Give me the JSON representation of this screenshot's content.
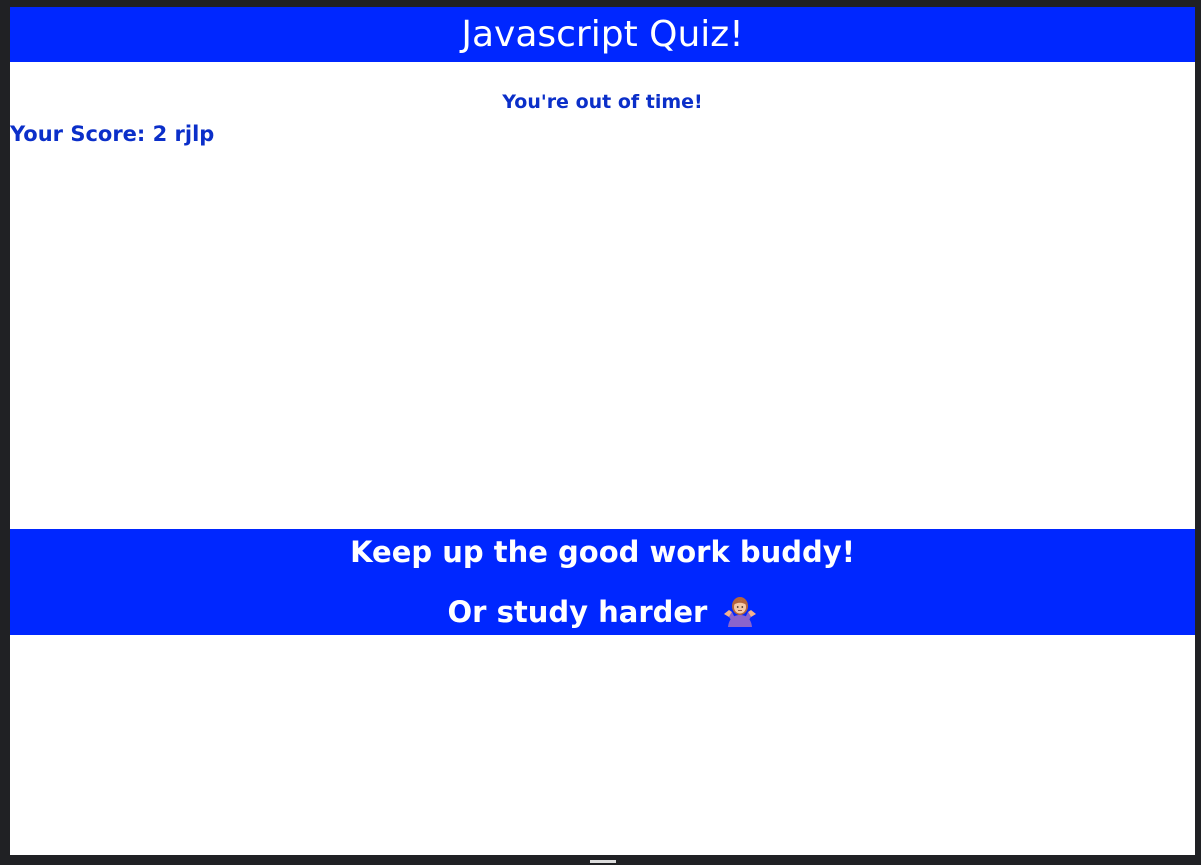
{
  "header": {
    "title": "Javascript Quiz!"
  },
  "result": {
    "timeout_message": "You're out of time!",
    "score_text": "Your Score: 2 rjlp"
  },
  "footer": {
    "line1": "Keep up the good work buddy!",
    "line2": "Or study harder"
  },
  "icons": {
    "shrug": "woman-shrugging-icon"
  },
  "colors": {
    "brand_blue": "#0027ff",
    "text_blue": "#0b2fc9",
    "background": "#ffffff",
    "frame": "#202124"
  }
}
